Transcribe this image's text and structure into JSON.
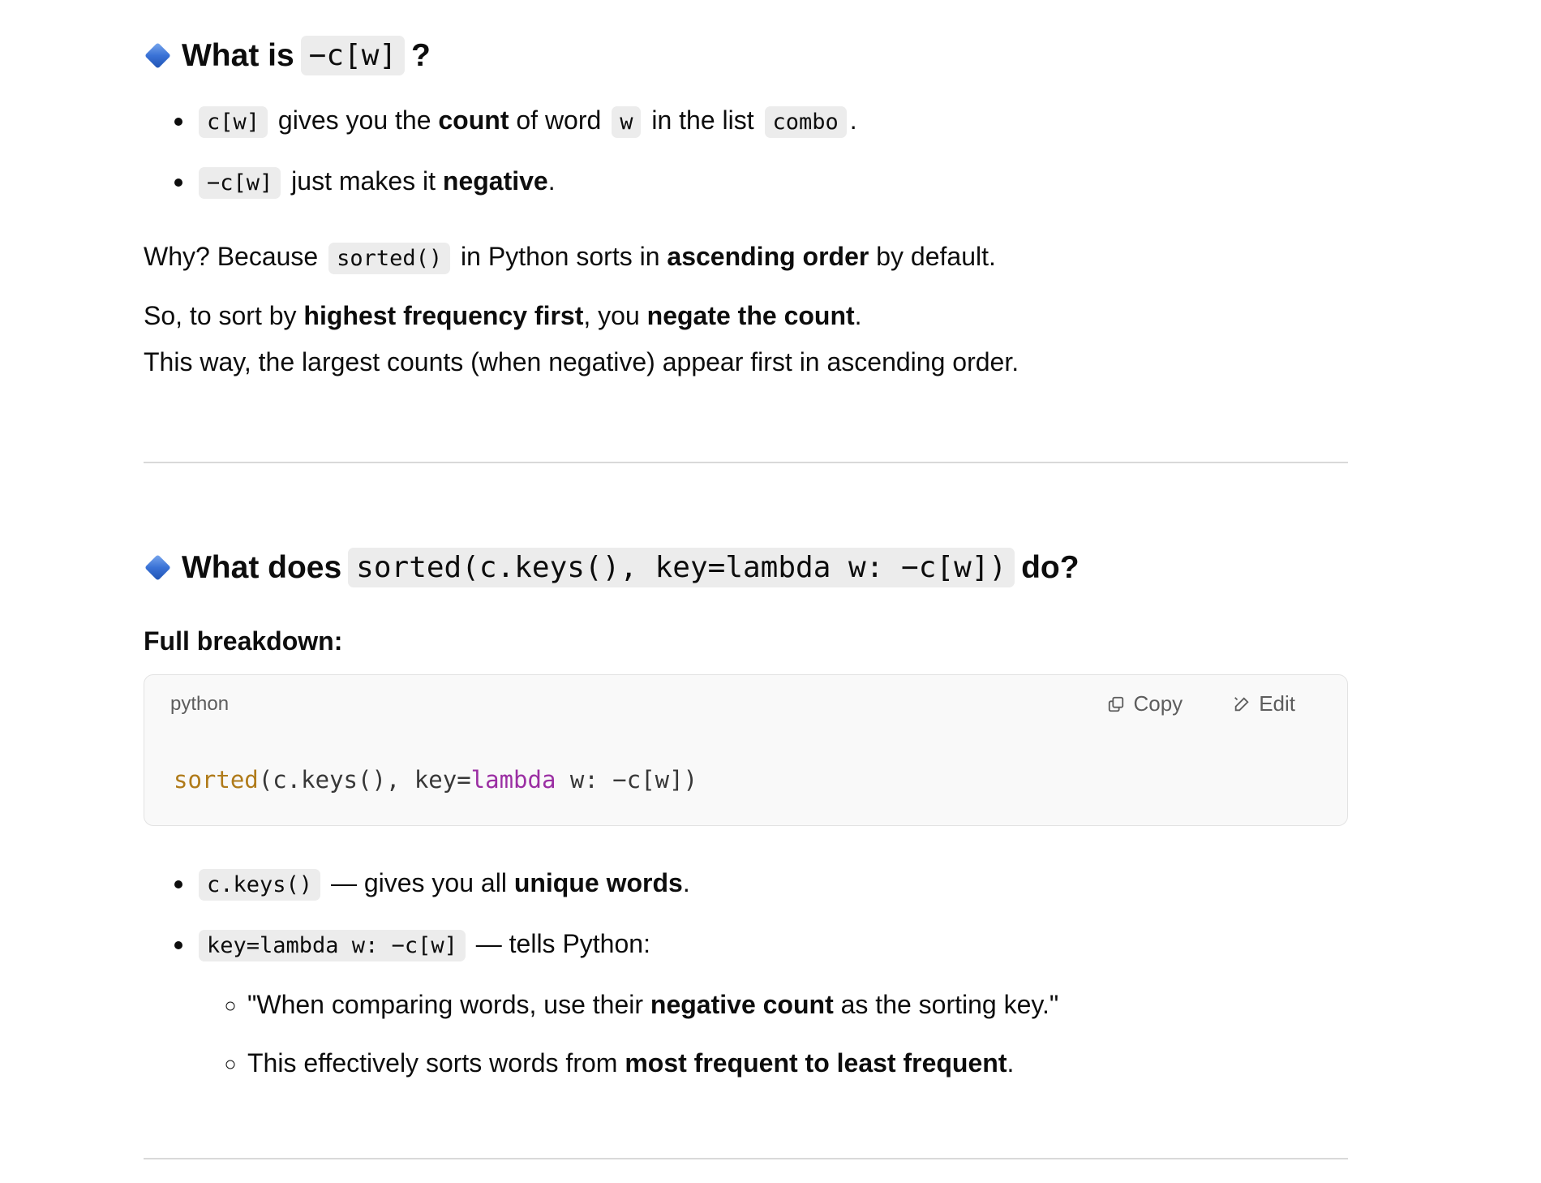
{
  "section1": {
    "heading_prefix": "What is",
    "heading_code": "−c[w]",
    "heading_suffix": "?",
    "bullets": [
      {
        "code": "c[w]",
        "t1": "gives you the",
        "b1": "count",
        "t2": "of word",
        "code2": "w",
        "t3": "in the list",
        "code3": "combo",
        "t4": "."
      },
      {
        "code": "−c[w]",
        "t1": "just makes it",
        "b1": "negative",
        "t2": "."
      }
    ],
    "p1": {
      "t1": "Why? Because",
      "code": "sorted()",
      "t2": "in Python sorts in",
      "b1": "ascending order",
      "t3": "by default."
    },
    "p2": {
      "t1": "So, to sort by",
      "b1": "highest frequency first",
      "t2": ", you",
      "b2": "negate the count",
      "t3": "."
    },
    "p3": "This way, the largest counts (when negative) appear first in ascending order."
  },
  "section2": {
    "heading_prefix": "What does",
    "heading_code": "sorted(c.keys(), key=lambda w: −c[w])",
    "heading_suffix": "do?",
    "subheading": "Full breakdown:",
    "code_block": {
      "language": "python",
      "copy_label": "Copy",
      "edit_label": "Edit",
      "tok_fn": "sorted",
      "tok_a": "(c.keys(), key=",
      "tok_kw": "lambda",
      "tok_b": " w: −c[w])"
    },
    "bullets": [
      {
        "code": "c.keys()",
        "t1": "— gives you all",
        "b1": "unique words",
        "t2": "."
      },
      {
        "code": "key=lambda w: −c[w]",
        "t1": "— tells Python:"
      }
    ],
    "sub_bullets": [
      {
        "t1": "\"When comparing words, use their",
        "b1": "negative count",
        "t2": "as the sorting key.\""
      },
      {
        "t1": "This effectively sorts words from",
        "b1": "most frequent to least frequent",
        "t2": "."
      }
    ]
  },
  "colors": {
    "accent_fn": "#b07b1a",
    "accent_kw": "#9b2fa3",
    "diamond": "#3a72d6"
  }
}
